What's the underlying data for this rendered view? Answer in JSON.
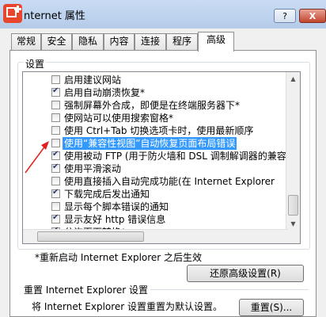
{
  "window": {
    "title": "nternet 属性",
    "help_label": "?",
    "close_label": "X"
  },
  "tabs": [
    {
      "label": "常规"
    },
    {
      "label": "安全"
    },
    {
      "label": "隐私"
    },
    {
      "label": "内容"
    },
    {
      "label": "连接"
    },
    {
      "label": "程序"
    },
    {
      "label": "高级"
    }
  ],
  "settings": {
    "group_label": "设置",
    "items": [
      {
        "label": "启用建议网站",
        "checked": false
      },
      {
        "label": "启用自动崩溃恢复*",
        "checked": true
      },
      {
        "label": "强制屏幕外合成，即便是在终端服务器下*",
        "checked": false
      },
      {
        "label": "使网站可以使用搜索窗格*",
        "checked": false
      },
      {
        "label": "使用 Ctrl+Tab 切换选项卡时，使用最新顺序",
        "checked": false
      },
      {
        "label": "使用“兼容性视图”自动恢复页面布局错误",
        "checked": false
      },
      {
        "label": "使用被动 FTP (用于防火墙和 DSL 调制解调器的兼容",
        "checked": true
      },
      {
        "label": "使用平滑滚动",
        "checked": true
      },
      {
        "label": "使用直接插入自动完成功能(在 Internet Explorer",
        "checked": false
      },
      {
        "label": "下载完成后发出通知",
        "checked": true
      },
      {
        "label": "显示每个脚本错误的通知",
        "checked": false
      },
      {
        "label": "显示友好 http 错误信息",
        "checked": true
      },
      {
        "label": "分许页面转换*",
        "checked": true
      }
    ],
    "selected_index": 5
  },
  "restart_note": "*重新启动 Internet Explorer 之后生效",
  "restore_button_label": "还原高级设置(R)",
  "reset": {
    "section_label": "重置 Internet Explorer 设置",
    "description": "将 Internet Explorer 设置重置为默认设置。",
    "button_label": "重置(S)..."
  },
  "colors": {
    "selection": "#3399ff",
    "annotation_arrow": "#e02020"
  }
}
